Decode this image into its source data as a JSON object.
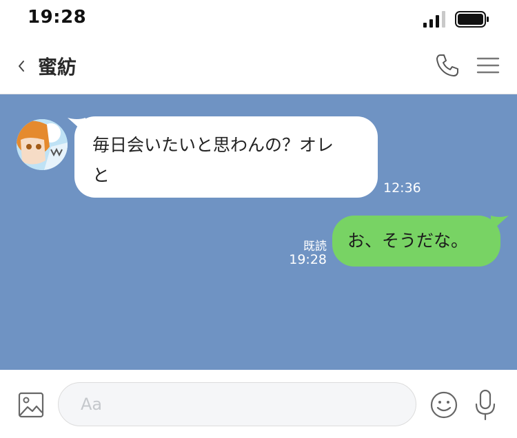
{
  "status_bar": {
    "time": "19:28",
    "signal_icon": "cellular-signal-icon",
    "battery_icon": "battery-icon"
  },
  "header": {
    "back_icon": "chevron-left-icon",
    "title": "蜜紡",
    "call_icon": "phone-icon",
    "menu_icon": "hamburger-menu-icon"
  },
  "messages": [
    {
      "direction": "incoming",
      "text_line_1": "毎日会いたいと思わんの？オレ",
      "text_line_2": "と",
      "time": "12:36"
    },
    {
      "direction": "outgoing",
      "text": "お、そうだな。",
      "read_label": "既読",
      "time": "19:28"
    }
  ],
  "composer": {
    "placeholder": "Aa",
    "value": "",
    "image_icon": "image-icon",
    "emoji_icon": "emoji-icon",
    "mic_icon": "microphone-icon"
  },
  "colors": {
    "chat_background": "#6f93c3",
    "incoming_bubble": "#ffffff",
    "outgoing_bubble": "#78d364"
  }
}
